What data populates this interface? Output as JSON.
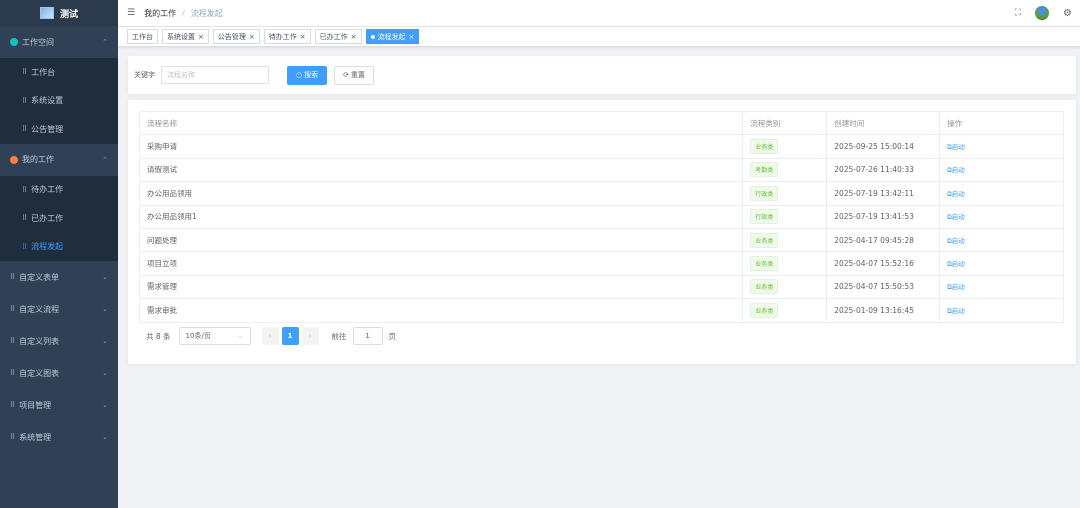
{
  "sidebar": {
    "logo_text": "测试",
    "items": [
      {
        "label": "工作空间",
        "icon": "dot-teal",
        "type": "group",
        "chev": "^"
      },
      {
        "label": "工作台",
        "icon": "grid-icon",
        "type": "sub"
      },
      {
        "label": "系统设置",
        "icon": "grid-icon",
        "type": "sub"
      },
      {
        "label": "公告管理",
        "icon": "grid-icon",
        "type": "sub"
      },
      {
        "label": "我的工作",
        "icon": "dot-orange",
        "type": "group",
        "chev": "^"
      },
      {
        "label": "待办工作",
        "icon": "grid-icon",
        "type": "sub"
      },
      {
        "label": "已办工作",
        "icon": "grid-icon",
        "type": "sub"
      },
      {
        "label": "流程发起",
        "icon": "grid-icon",
        "type": "sub",
        "active": true
      },
      {
        "label": "自定义表单",
        "icon": "grid-icon",
        "type": "group",
        "chev": "v"
      },
      {
        "label": "自定义流程",
        "icon": "grid-icon",
        "type": "group",
        "chev": "v"
      },
      {
        "label": "自定义列表",
        "icon": "grid-icon",
        "type": "group",
        "chev": "v"
      },
      {
        "label": "自定义图表",
        "icon": "grid-icon",
        "type": "group",
        "chev": "v"
      },
      {
        "label": "项目管理",
        "icon": "grid-icon",
        "type": "group",
        "chev": "v"
      },
      {
        "label": "系统管理",
        "icon": "grid-icon",
        "type": "group",
        "chev": "v"
      }
    ]
  },
  "header": {
    "breadcrumb_root": "我的工作",
    "breadcrumb_sep": "/",
    "breadcrumb_current": "流程发起"
  },
  "tags": [
    {
      "label": "工作台",
      "closable": false
    },
    {
      "label": "系统设置",
      "closable": true
    },
    {
      "label": "公告管理",
      "closable": true
    },
    {
      "label": "待办工作",
      "closable": true
    },
    {
      "label": "已办工作",
      "closable": true
    },
    {
      "label": "流程发起",
      "closable": true,
      "active": true
    }
  ],
  "search": {
    "label": "关键字",
    "placeholder": "流程名称",
    "search_btn": "搜索",
    "reset_btn": "重置"
  },
  "table": {
    "columns": [
      "流程名称",
      "流程类别",
      "创建时间",
      "操作"
    ],
    "action_label": "启动",
    "rows": [
      {
        "name": "采购申请",
        "category": "业务类",
        "created": "2025-09-25 15:00:14"
      },
      {
        "name": "请假测试",
        "category": "考勤类",
        "created": "2025-07-26 11:40:33"
      },
      {
        "name": "办公用品领用",
        "category": "行政类",
        "created": "2025-07-19 13:42:11"
      },
      {
        "name": "办公用品领用1",
        "category": "行政类",
        "created": "2025-07-19 13:41:53"
      },
      {
        "name": "问题处理",
        "category": "业务类",
        "created": "2025-04-17 09:45:28"
      },
      {
        "name": "项目立项",
        "category": "业务类",
        "created": "2025-04-07 15:52:16"
      },
      {
        "name": "需求管理",
        "category": "业务类",
        "created": "2025-04-07 15:50:53"
      },
      {
        "name": "需求审批",
        "category": "业务类",
        "created": "2025-01-09 13:16:45"
      }
    ]
  },
  "pagination": {
    "total_text": "共 8 条",
    "page_size": "10条/页",
    "current_page": "1",
    "goto_label": "前往",
    "goto_value": "1",
    "goto_suffix": "页"
  }
}
